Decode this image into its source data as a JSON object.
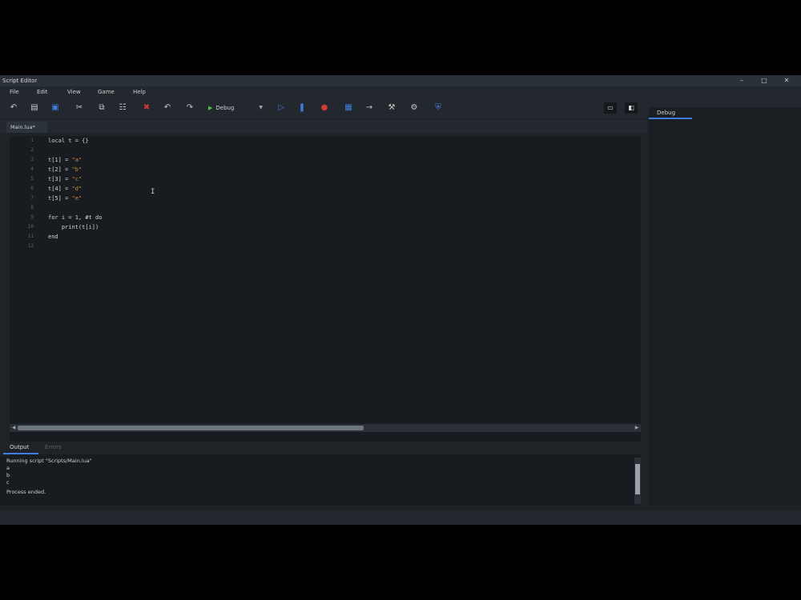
{
  "window": {
    "title": "Script Editor"
  },
  "menus": [
    "File",
    "Edit",
    "View",
    "Game",
    "Help"
  ],
  "toolbar": {
    "config": "Debug"
  },
  "file_tab": "Main.lua*",
  "right_panel": {
    "tab": "Debug"
  },
  "editor": {
    "line_numbers": [
      "1",
      "2",
      "3",
      "4",
      "5",
      "6",
      "7",
      "8",
      "9",
      "10",
      "11",
      "12"
    ],
    "lines": [
      {
        "text": "local t = {}"
      },
      {
        "text": ""
      },
      {
        "pre": "t[1] = ",
        "str": "\"a\""
      },
      {
        "pre": "t[2] = ",
        "str": "\"b\""
      },
      {
        "pre": "t[3] = ",
        "str": "\"c\""
      },
      {
        "pre": "t[4] = ",
        "str": "\"d\""
      },
      {
        "pre": "t[5] = ",
        "str": "\"e\""
      },
      {
        "text": ""
      },
      {
        "text": "for i = 1, #t do"
      },
      {
        "text": "    print(t[i])"
      },
      {
        "text": "end"
      },
      {
        "text": ""
      }
    ]
  },
  "bottom_tabs": {
    "output": "Output",
    "errors": "Errors"
  },
  "output": {
    "lines": [
      "Running script \"Scripts/Main.lua\"",
      "a",
      "b",
      "c",
      "Process ended."
    ]
  },
  "colors": {
    "accent": "#3f7de0",
    "string": "#d08c3a",
    "run": "#4fbf4f",
    "stop": "#d03a34"
  }
}
